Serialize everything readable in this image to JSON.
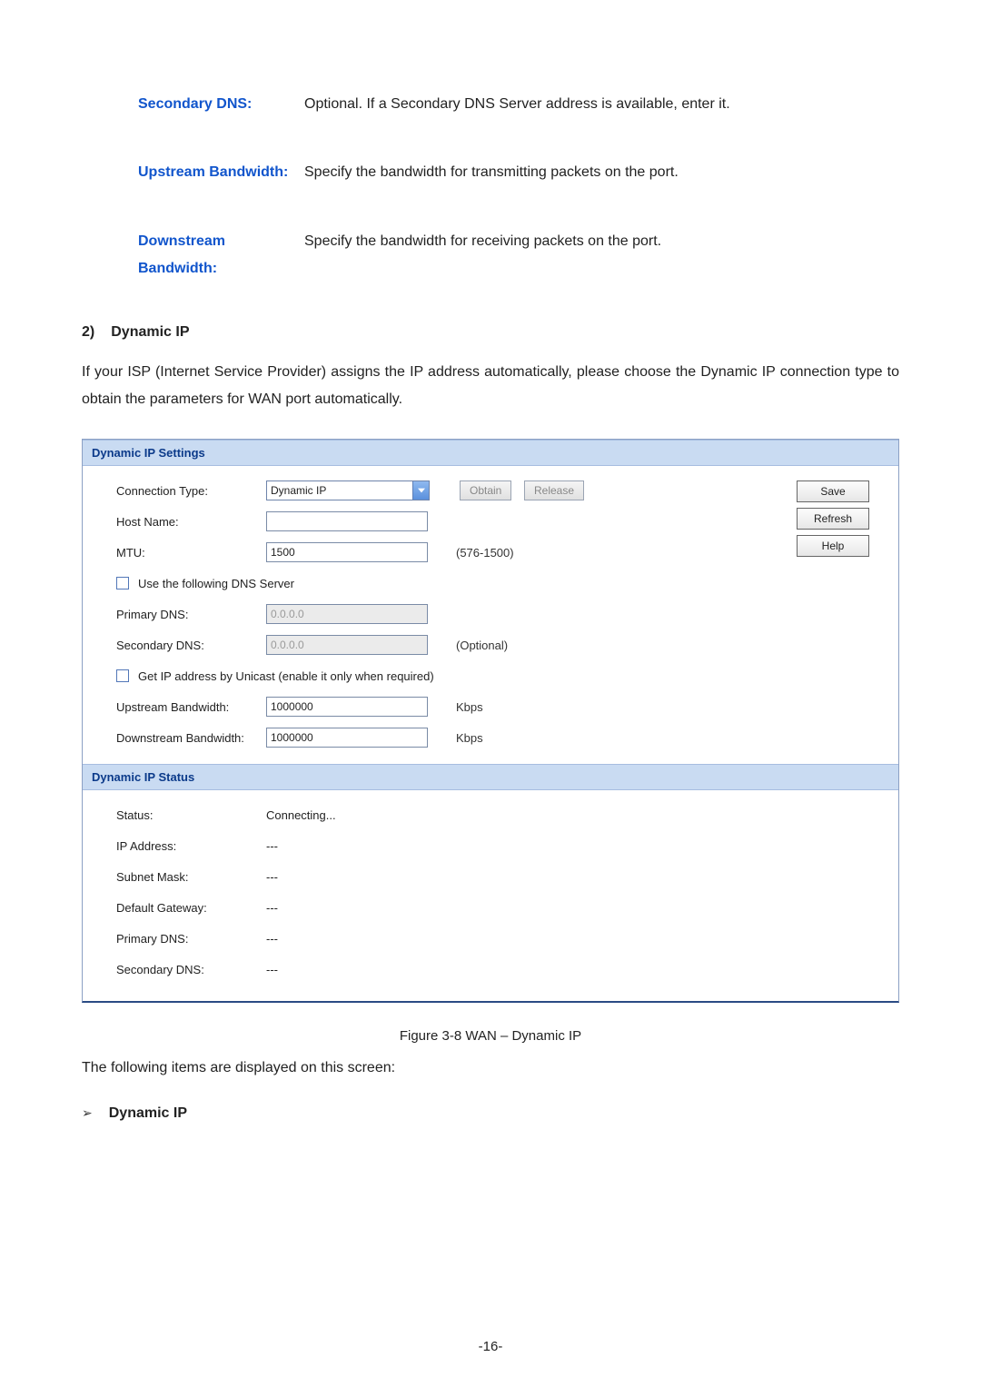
{
  "defs": {
    "secondary_dns": {
      "label": "Secondary DNS:",
      "text": "Optional. If a Secondary DNS Server address is available, enter it."
    },
    "upstream_bw": {
      "label": "Upstream Bandwidth:",
      "text": "Specify the bandwidth for transmitting packets on the port."
    },
    "downstream_bw": {
      "label": "Downstream Bandwidth:",
      "text": "Specify the bandwidth for receiving packets on the port."
    }
  },
  "section": {
    "num": "2)",
    "title": "Dynamic IP",
    "para": "If your ISP (Internet Service Provider) assigns the IP address automatically, please choose the Dynamic IP connection type to obtain the parameters for WAN port automatically."
  },
  "panel": {
    "strip_settings": "Dynamic IP Settings",
    "strip_status": "Dynamic IP Status",
    "rows": {
      "conn_type": {
        "label": "Connection Type:",
        "value": "Dynamic IP"
      },
      "obtain_btn": "Obtain",
      "release_btn": "Release",
      "host_name": {
        "label": "Host Name:",
        "value": ""
      },
      "mtu": {
        "label": "MTU:",
        "value": "1500",
        "note": "(576-1500)"
      },
      "use_dns_chk": "Use the following DNS Server",
      "primary_dns": {
        "label": "Primary DNS:",
        "placeholder": "0.0.0.0"
      },
      "secondary_dns": {
        "label": "Secondary DNS:",
        "placeholder": "0.0.0.0",
        "note": "(Optional)"
      },
      "unicast_chk": "Get IP address by Unicast (enable it only when required)",
      "up_bw": {
        "label": "Upstream Bandwidth:",
        "value": "1000000",
        "unit": "Kbps"
      },
      "down_bw": {
        "label": "Downstream Bandwidth:",
        "value": "1000000",
        "unit": "Kbps"
      }
    },
    "side": {
      "save": "Save",
      "refresh": "Refresh",
      "help": "Help"
    },
    "status": {
      "status": {
        "label": "Status:",
        "value": "Connecting..."
      },
      "ip": {
        "label": "IP Address:",
        "value": "---"
      },
      "mask": {
        "label": "Subnet Mask:",
        "value": "---"
      },
      "gw": {
        "label": "Default Gateway:",
        "value": "---"
      },
      "pdns": {
        "label": "Primary DNS:",
        "value": "---"
      },
      "sdns": {
        "label": "Secondary DNS:",
        "value": "---"
      }
    }
  },
  "caption": "Figure 3-8 WAN – Dynamic IP",
  "after_caption": "The following items are displayed on this screen:",
  "bullet": {
    "arrow": "➢",
    "title": "Dynamic IP"
  },
  "page_number": "-16-"
}
